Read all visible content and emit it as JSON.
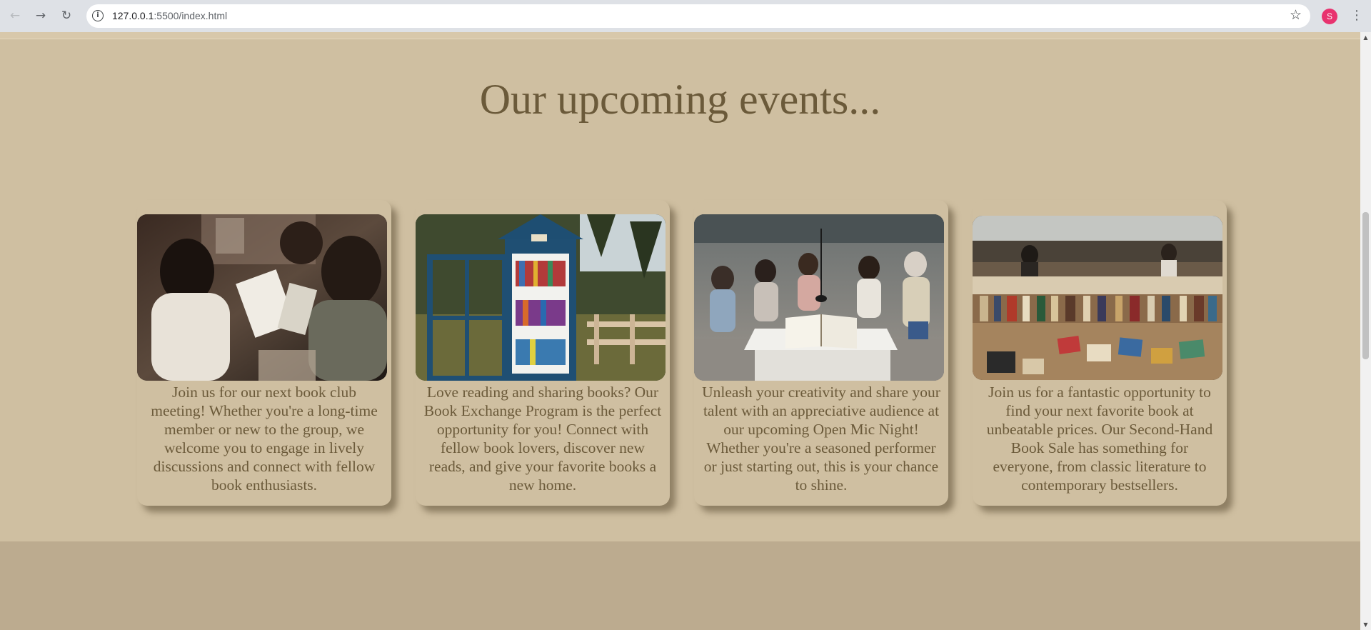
{
  "browser": {
    "back_icon": "←",
    "forward_icon": "→",
    "reload_icon": "↻",
    "site_info_icon": "i",
    "url_host": "127.0.0.1",
    "url_path": ":5500/index.html",
    "bookmark_icon": "☆",
    "profile_initial": "S",
    "menu_icon": "⋮"
  },
  "page": {
    "title": "Our upcoming events...",
    "events": [
      {
        "image": "book-club-photo",
        "text": "Join us for our next book club meeting! Whether you're a long-time member or new to the group, we welcome you to engage in lively discussions and connect with fellow book enthusiasts."
      },
      {
        "image": "book-exchange-photo",
        "text": "Love reading and sharing books? Our Book Exchange Program is the perfect opportunity for you! Connect with fellow book lovers, discover new reads, and give your favorite books a new home."
      },
      {
        "image": "open-mic-photo",
        "text": "Unleash your creativity and share your talent with an appreciative audience at our upcoming Open Mic Night! Whether you're a seasoned performer or just starting out, this is your chance to shine."
      },
      {
        "image": "book-sale-photo",
        "text": "Join us for a fantastic opportunity to find your next favorite book at unbeatable prices. Our Second-Hand Book Sale has something for everyone, from classic literature to contemporary bestsellers."
      }
    ]
  },
  "scrollbar": {
    "up_icon": "▲",
    "down_icon": "▼",
    "position": 0.28
  },
  "colors": {
    "page_background": "#cfbfa1",
    "title_text": "#6b5a3a",
    "lower_band": "#bcab8f",
    "avatar": "#e8336f"
  }
}
